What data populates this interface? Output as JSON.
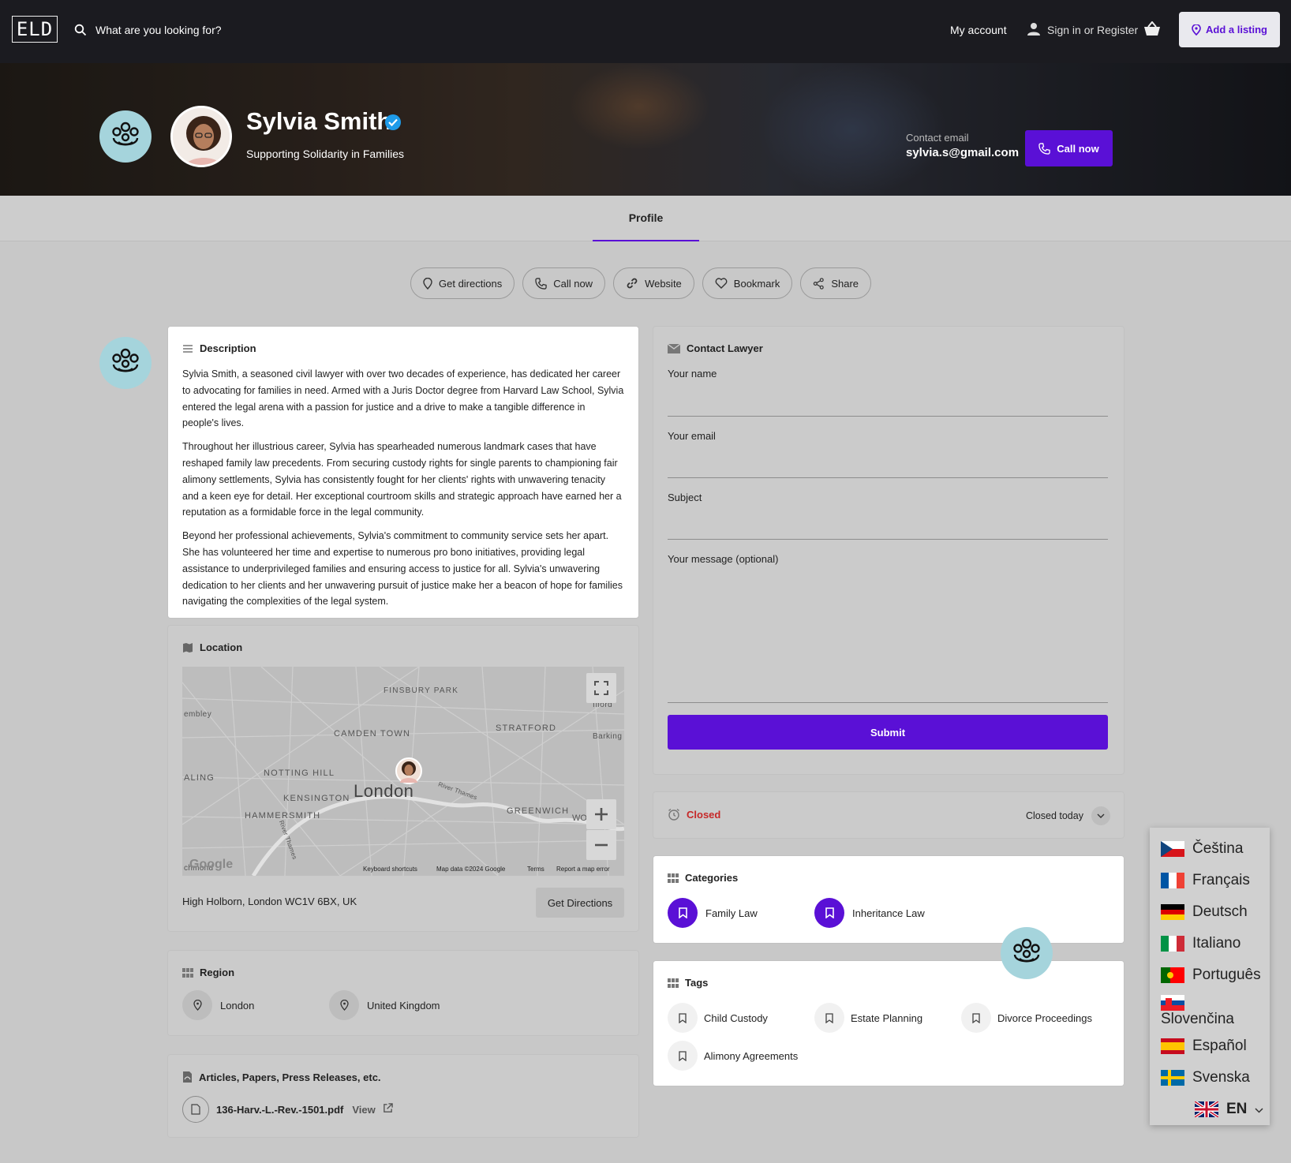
{
  "header": {
    "logo_text": "ELD",
    "search_placeholder": "What are you looking for?",
    "my_account": "My account",
    "sign_in": "Sign in or Register",
    "add_listing": "Add a listing"
  },
  "profile": {
    "name": "Sylvia Smith",
    "tagline": "Supporting Solidarity in Families",
    "contact_label": "Contact email",
    "contact_email": "sylvia.s@gmail.com",
    "call_now": "Call now"
  },
  "tabs": [
    {
      "label": "Profile"
    }
  ],
  "actions": {
    "directions": "Get directions",
    "call": "Call now",
    "website": "Website",
    "bookmark": "Bookmark",
    "share": "Share"
  },
  "description": {
    "title": "Description",
    "paragraphs": [
      "Sylvia Smith, a seasoned civil lawyer with over two decades of experience, has dedicated her career to advocating for families in need. Armed with a Juris Doctor degree from Harvard Law School, Sylvia entered the legal arena with a passion for justice and a drive to make a tangible difference in people's lives.",
      "Throughout her illustrious career, Sylvia has spearheaded numerous landmark cases that have reshaped family law precedents. From securing custody rights for single parents to championing fair alimony settlements, Sylvia has consistently fought for her clients' rights with unwavering tenacity and a keen eye for detail. Her exceptional courtroom skills and strategic approach have earned her a reputation as a formidable force in the legal community.",
      "Beyond her professional achievements, Sylvia's commitment to community service sets her apart. She has volunteered her time and expertise to numerous pro bono initiatives, providing legal assistance to underprivileged families and ensuring access to justice for all. Sylvia's unwavering dedication to her clients and her unwavering pursuit of justice make her a beacon of hope for families navigating the complexities of the legal system."
    ]
  },
  "location": {
    "title": "Location",
    "map_labels": {
      "finsbury": "FINSBURY PARK",
      "wembley": "embley",
      "ilford": "Ilford",
      "camden": "CAMDEN TOWN",
      "stratford": "STRATFORD",
      "barking": "Barking",
      "ealing": "ALING",
      "notting": "NOTTING HILL",
      "london": "London",
      "thames": "River Thames",
      "kensington": "KENSINGTON",
      "hammersmith": "HAMMERSMITH",
      "greenwich": "GREENWICH",
      "woolwich": "WO      CH",
      "richmond": "chmond",
      "thames2": "River Thames",
      "google": "Google"
    },
    "map_footer": {
      "shortcuts": "Keyboard shortcuts",
      "data": "Map data ©2024 Google",
      "terms": "Terms",
      "report": "Report a map error"
    },
    "address": "High Holborn, London WC1V 6BX, UK",
    "get_directions": "Get Directions"
  },
  "region": {
    "title": "Region",
    "items": [
      "London",
      "United Kingdom"
    ]
  },
  "articles": {
    "title": "Articles, Papers, Press Releases, etc.",
    "file_name": "136-Harv.-L.-Rev.-1501.pdf",
    "view": "View"
  },
  "contact_form": {
    "title": "Contact Lawyer",
    "name_label": "Your name",
    "email_label": "Your email",
    "subject_label": "Subject",
    "message_label": "Your message (optional)",
    "submit": "Submit"
  },
  "hours": {
    "status": "Closed",
    "today": "Closed today"
  },
  "categories": {
    "title": "Categories",
    "items": [
      "Family Law",
      "Inheritance Law"
    ]
  },
  "tags": {
    "title": "Tags",
    "items": [
      "Child Custody",
      "Estate Planning",
      "Divorce Proceedings",
      "Alimony Agreements"
    ]
  },
  "languages": {
    "items": [
      "Čeština",
      "Français",
      "Deutsch",
      "Italiano",
      "Português",
      "Slovenčina",
      "Español",
      "Svenska"
    ],
    "current": "EN"
  },
  "colors": {
    "accent": "#5a10d6",
    "closed": "#c62828",
    "verified": "#1e9be9",
    "badge": "#a5d4dc"
  }
}
